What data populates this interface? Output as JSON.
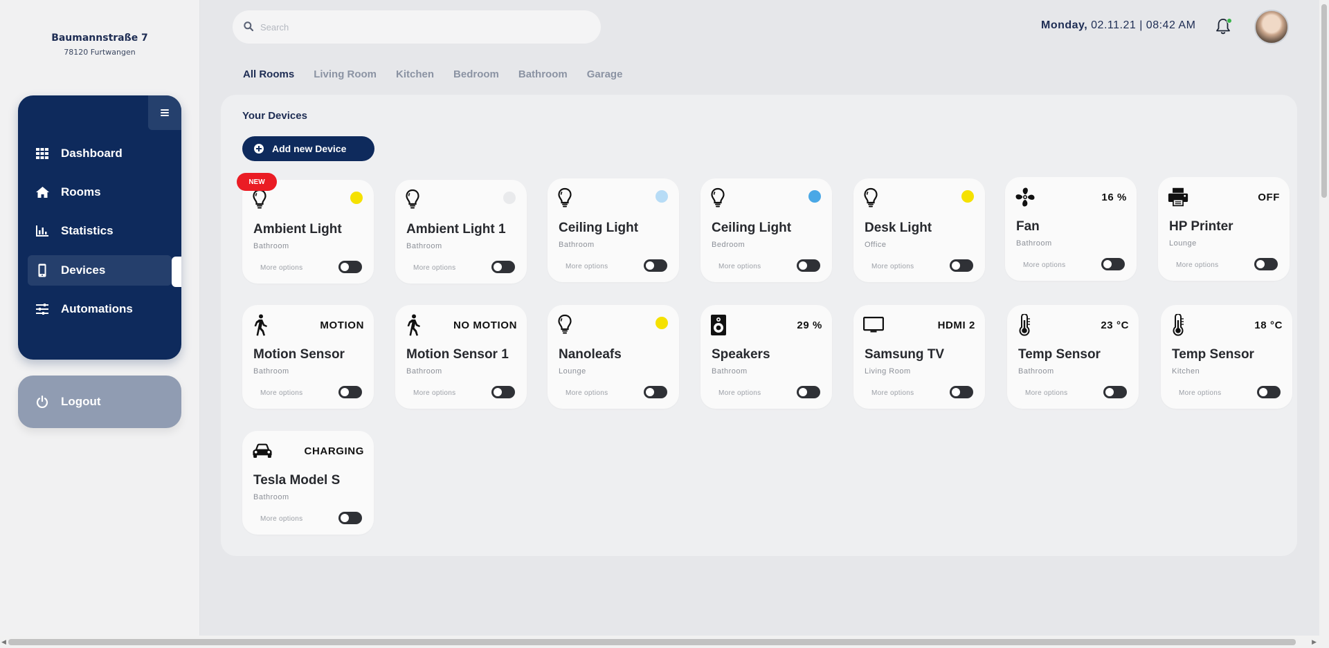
{
  "address": {
    "street": "Baumannstraße 7",
    "city": "78120 Furtwangen"
  },
  "nav": {
    "items": [
      {
        "label": "Dashboard",
        "icon": "grid-icon"
      },
      {
        "label": "Rooms",
        "icon": "home-icon"
      },
      {
        "label": "Statistics",
        "icon": "chart-icon"
      },
      {
        "label": "Devices",
        "icon": "phone-icon"
      },
      {
        "label": "Automations",
        "icon": "sliders-icon"
      }
    ],
    "active": "Devices",
    "logout_label": "Logout"
  },
  "header": {
    "search_placeholder": "Search",
    "day": "Monday,",
    "datetime": "02.11.21 | 08:42 AM"
  },
  "tabs": [
    "All Rooms",
    "Living Room",
    "Kitchen",
    "Bedroom",
    "Bathroom",
    "Garage"
  ],
  "active_tab": "All Rooms",
  "devices_panel": {
    "title": "Your Devices",
    "add_button": "Add new Device",
    "more_options": "More options",
    "new_badge": "NEW"
  },
  "devices": [
    {
      "name": "Ambient Light",
      "room": "Bathroom",
      "icon": "bulb-icon",
      "state": "",
      "dot": "#f5e100"
    },
    {
      "name": "Ambient Light 1",
      "room": "Bathroom",
      "icon": "bulb-icon",
      "state": "",
      "dot": "#e9eaec"
    },
    {
      "name": "Ceiling Light",
      "room": "Bathroom",
      "icon": "bulb-icon",
      "state": "",
      "dot": "#b7dcf6"
    },
    {
      "name": "Ceiling Light",
      "room": "Bedroom",
      "icon": "bulb-icon",
      "state": "",
      "dot": "#4aa8e6"
    },
    {
      "name": "Desk Light",
      "room": "Office",
      "icon": "bulb-icon",
      "state": "",
      "dot": "#f5e100"
    },
    {
      "name": "Fan",
      "room": "Bathroom",
      "icon": "fan-icon",
      "state": "16 %",
      "dot": ""
    },
    {
      "name": "HP Printer",
      "room": "Lounge",
      "icon": "printer-icon",
      "state": "OFF",
      "dot": ""
    },
    {
      "name": "Motion Sensor",
      "room": "Bathroom",
      "icon": "walking-icon",
      "state": "MOTION",
      "dot": ""
    },
    {
      "name": "Motion Sensor 1",
      "room": "Bathroom",
      "icon": "walking-icon",
      "state": "NO MOTION",
      "dot": ""
    },
    {
      "name": "Nanoleafs",
      "room": "Lounge",
      "icon": "bulb-icon",
      "state": "",
      "dot": "#f5e100"
    },
    {
      "name": "Speakers",
      "room": "Bathroom",
      "icon": "speaker-icon",
      "state": "29 %",
      "dot": ""
    },
    {
      "name": "Samsung TV",
      "room": "Living Room",
      "icon": "tv-icon",
      "state": "HDMI 2",
      "dot": ""
    },
    {
      "name": "Temp Sensor",
      "room": "Bathroom",
      "icon": "thermometer-icon",
      "state": "23 °C",
      "dot": ""
    },
    {
      "name": "Temp Sensor",
      "room": "Kitchen",
      "icon": "thermometer-icon",
      "state": "18 °C",
      "dot": ""
    },
    {
      "name": "Tesla Model S",
      "room": "Bathroom",
      "icon": "car-icon",
      "state": "CHARGING",
      "dot": ""
    }
  ],
  "colors": {
    "navy": "#0e2a5c",
    "badge_red": "#ea1c24",
    "online": "#39b54a"
  }
}
